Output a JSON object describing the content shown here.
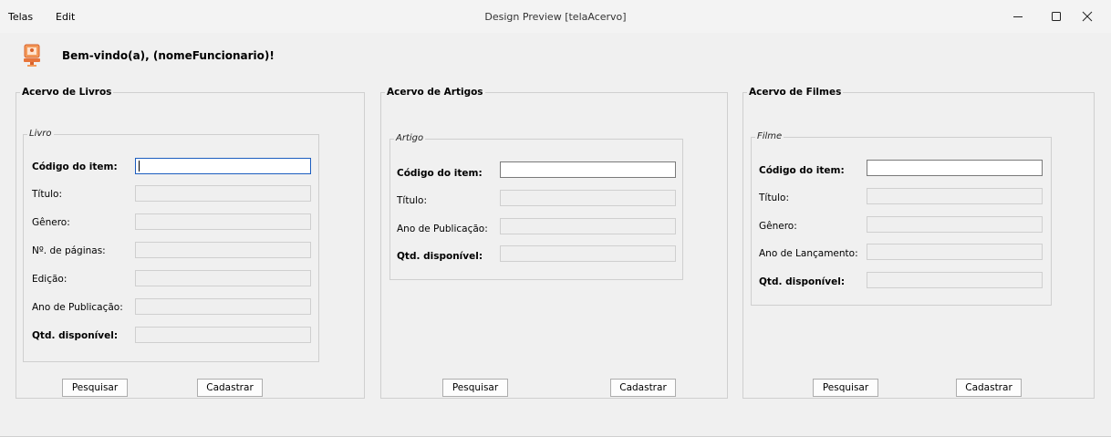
{
  "menu": [
    "Telas",
    "Edit"
  ],
  "window_title": "Design Preview [telaAcervo]",
  "window_controls": {
    "minimize": "minimize-icon",
    "maximize": "maximize-icon",
    "close": "close-icon"
  },
  "welcome": "Bem-vindo(a), (nomeFuncionario)!",
  "livros": {
    "title": "Acervo de Livros",
    "subgroup": "Livro",
    "labels": {
      "codigo": "Código do item:",
      "titulo": "Título:",
      "genero": "Gênero:",
      "paginas": "Nº. de páginas:",
      "edicao": "Edição:",
      "ano": "Ano de Publicação:",
      "qtd": "Qtd. disponível:"
    },
    "values": {
      "codigo": "",
      "titulo": "",
      "genero": "",
      "paginas": "",
      "edicao": "",
      "ano": "",
      "qtd": ""
    },
    "buttons": {
      "pesquisar": "Pesquisar",
      "cadastrar": "Cadastrar"
    }
  },
  "artigos": {
    "title": "Acervo de Artigos",
    "subgroup": "Artigo",
    "labels": {
      "codigo": "Código do item:",
      "titulo": "Título:",
      "ano": "Ano de Publicação:",
      "qtd": "Qtd. disponível:"
    },
    "values": {
      "codigo": "",
      "titulo": "",
      "ano": "",
      "qtd": ""
    },
    "buttons": {
      "pesquisar": "Pesquisar",
      "cadastrar": "Cadastrar"
    }
  },
  "filmes": {
    "title": "Acervo de Filmes",
    "subgroup": "Filme",
    "labels": {
      "codigo": "Código do item:",
      "titulo": "Título:",
      "genero": "Gênero:",
      "ano": "Ano de Lançamento:",
      "qtd": "Qtd. disponível:"
    },
    "values": {
      "codigo": "",
      "titulo": "",
      "genero": "",
      "ano": "",
      "qtd": ""
    },
    "buttons": {
      "pesquisar": "Pesquisar",
      "cadastrar": "Cadastrar"
    }
  },
  "colors": {
    "focus_border": "#1c5dbf",
    "panel_bg": "#f0f0f0",
    "titlebar_bg": "#f3f3f3",
    "disabled_field": "#efefef"
  }
}
